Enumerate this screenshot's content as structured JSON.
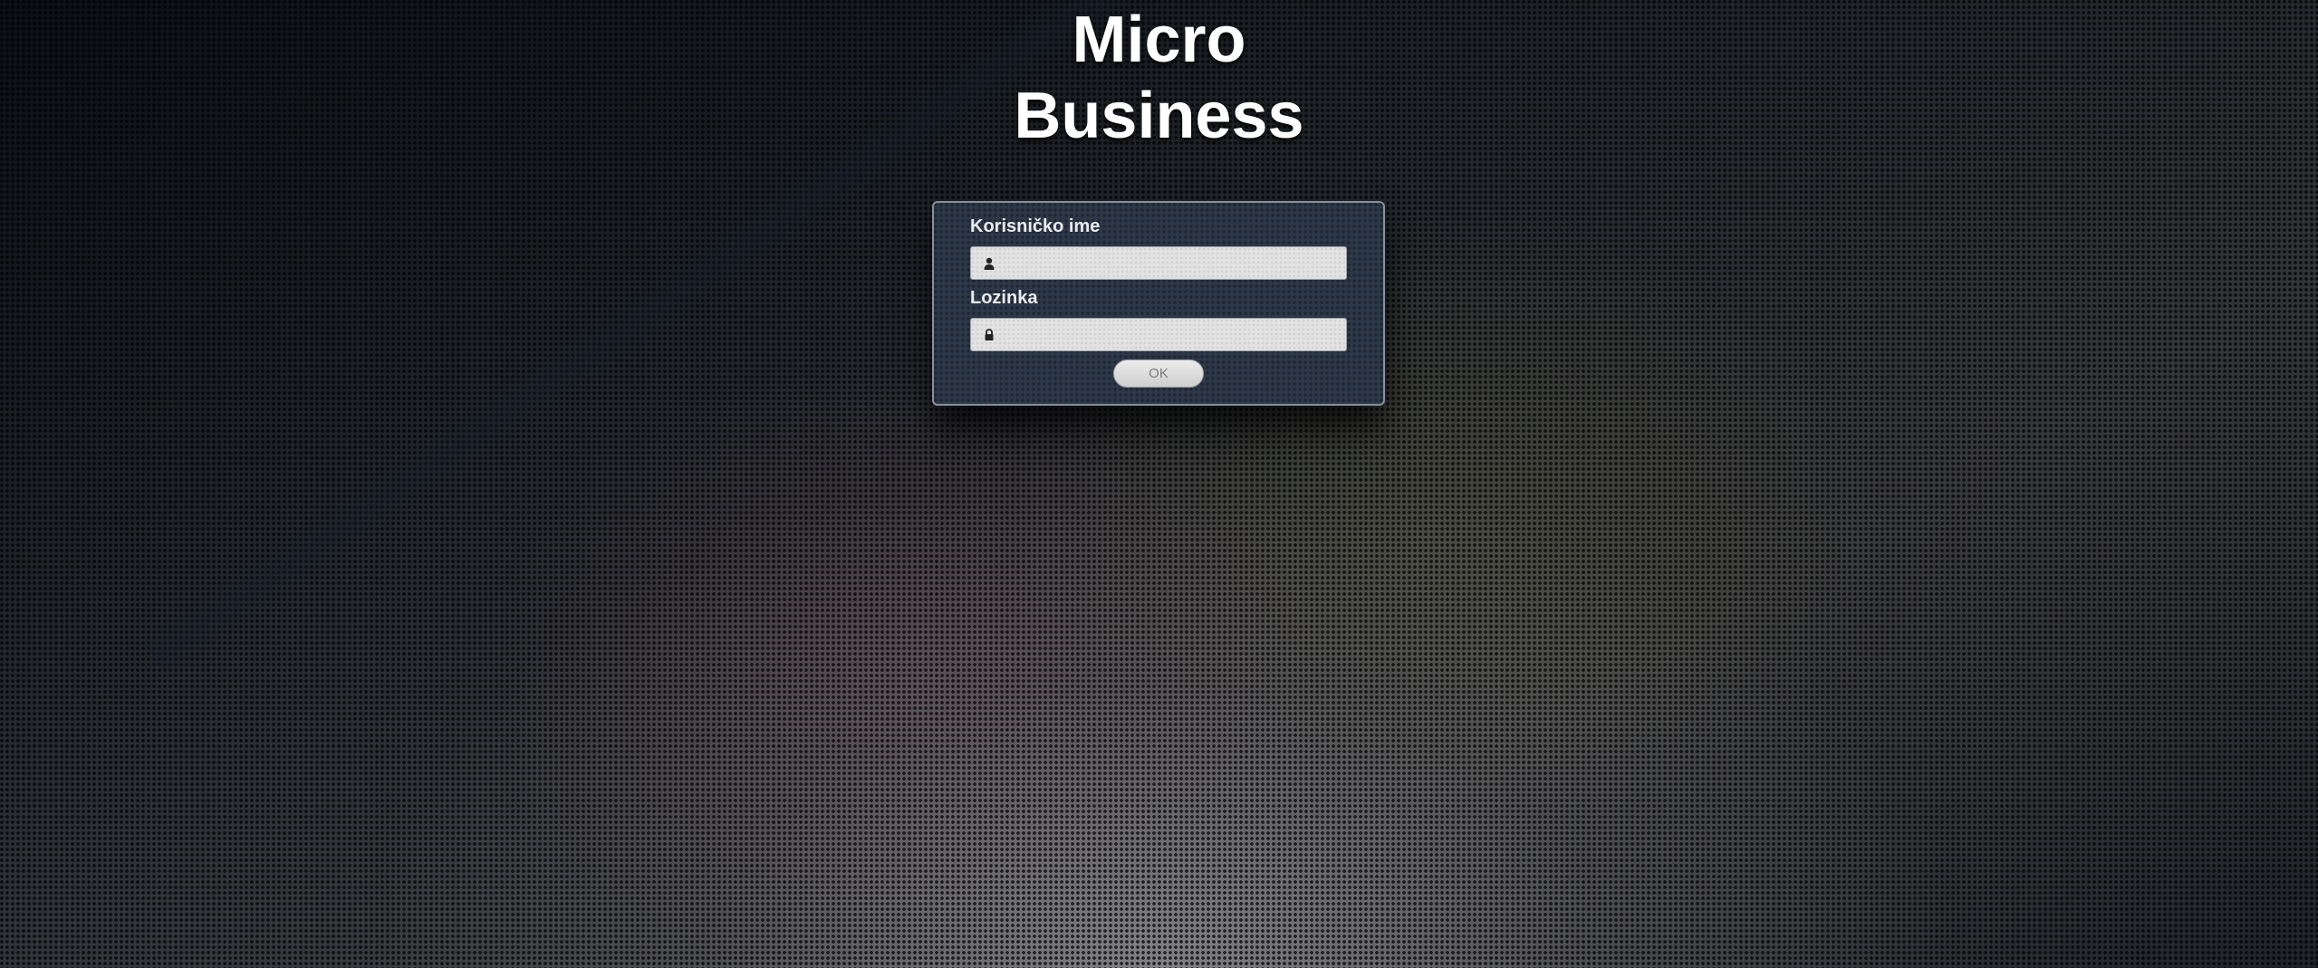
{
  "app": {
    "title_line1": "Micro",
    "title_line2": "Business"
  },
  "login": {
    "username_label": "Korisničko ime",
    "username_value": "",
    "password_label": "Lozinka",
    "password_value": "",
    "submit_label": "OK"
  },
  "icons": {
    "username_icon": "user-icon",
    "password_icon": "lock-icon"
  },
  "colors": {
    "panel_background": "#2c3848",
    "title_text": "#ffffff",
    "field_background": "#e2e2e2"
  }
}
